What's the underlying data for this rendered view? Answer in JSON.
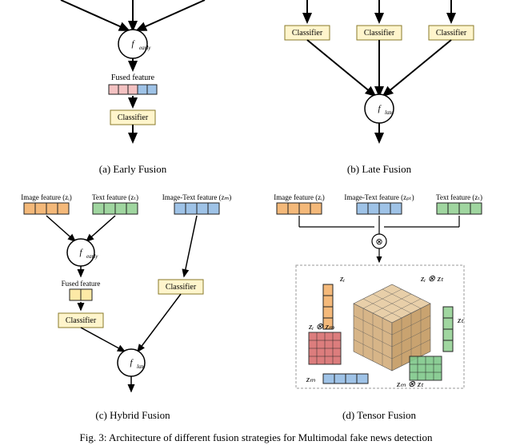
{
  "labels": {
    "image_feature": "Image feature (zᵢ)",
    "text_feature": "Text feature (zₜ)",
    "image_text_feature": "Image-Text feature (zₘ)",
    "image_text_feature_pt": "Image-Text feature (zₚₜ)",
    "fused_feature": "Fused feature",
    "classifier": "Classifier",
    "f_early": "f_early",
    "f_late": "f_late",
    "tensor_product": "⊗"
  },
  "tensor": {
    "zi": "zᵢ",
    "zm": "zₘ",
    "zt": "zₜ",
    "zi_zm": "zᵢ ⊗ zₘ",
    "zi_zt": "zᵢ ⊗ zₜ",
    "zm_zt": "zₘ ⊗ zₜ"
  },
  "captions": {
    "a": "(a) Early Fusion",
    "b": "(b) Late Fusion",
    "c": "(c) Hybrid Fusion",
    "d": "(d) Tensor Fusion",
    "fig": "Fig. 3: Architecture of different fusion strategies for Multimodal fake news detection"
  },
  "colors": {
    "image": "#f4b97a",
    "text": "#a0d6a0",
    "imagetext": "#9fc3e7",
    "fused_pink": "#f4c2c2",
    "fused_yellow": "#fde9a6",
    "classifier_bg": "#fff5cc"
  }
}
